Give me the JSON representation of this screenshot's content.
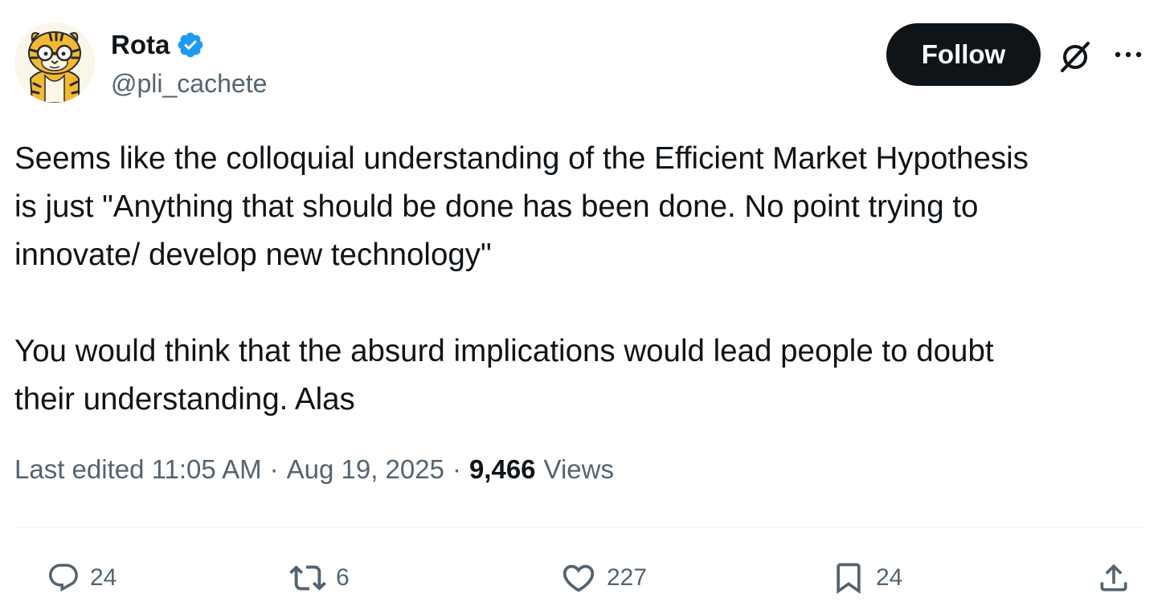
{
  "author": {
    "display_name": "Rota",
    "handle": "@pli_cachete",
    "verified": true,
    "avatar_icon": "tiger-cartoon-avatar"
  },
  "header": {
    "follow_label": "Follow",
    "grok_icon": "grok-icon",
    "more_icon": "more-horizontal-icon"
  },
  "tweet": {
    "text": "Seems like the colloquial understanding of the Efficient Market Hypothesis\nis just \"Anything that should be done has been done. No point trying to\ninnovate/ develop new technology\"\n\nYou would think that the absurd implications would lead people to doubt\ntheir understanding. Alas"
  },
  "meta": {
    "edited_time": "Last edited 11:05 AM",
    "separator": "·",
    "date": "Aug 19, 2025",
    "views_count": "9,466",
    "views_label": "Views"
  },
  "actions": {
    "replies": "24",
    "reposts": "6",
    "likes": "227",
    "bookmarks": "24"
  },
  "colors": {
    "text_primary": "#0f1419",
    "text_secondary": "#536471",
    "verified_blue": "#1d9bf0",
    "follow_bg": "#0f1419",
    "divider": "#eff3f4"
  }
}
